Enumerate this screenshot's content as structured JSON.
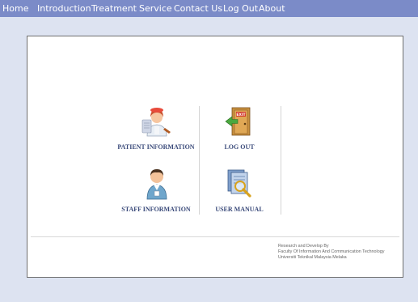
{
  "nav": {
    "items": [
      {
        "label": "Home"
      },
      {
        "label": "Introduction"
      },
      {
        "label": "Treatment"
      },
      {
        "label": "Service"
      },
      {
        "label": "Contact Us"
      },
      {
        "label": "Log Out"
      },
      {
        "label": "About"
      }
    ]
  },
  "menu": {
    "patient_info": {
      "label": "PATIENT INFORMATION",
      "icon": "nurse-icon"
    },
    "log_out": {
      "label": "LOG OUT",
      "icon": "exit-door-icon"
    },
    "staff_info": {
      "label": "STAFF INFORMATION",
      "icon": "staff-person-icon"
    },
    "user_manual": {
      "label": "USER MANUAL",
      "icon": "manual-search-icon"
    }
  },
  "footer": {
    "line1": "Research and Develop By",
    "line2": "Faculty Of Information And Communication Technology",
    "line3": "Universiti Teknikal Malaysia Melaka"
  },
  "colors": {
    "nav_bar": "#7b8bc8",
    "page_background": "#dde3f1",
    "label_text": "#3a4a7a"
  }
}
